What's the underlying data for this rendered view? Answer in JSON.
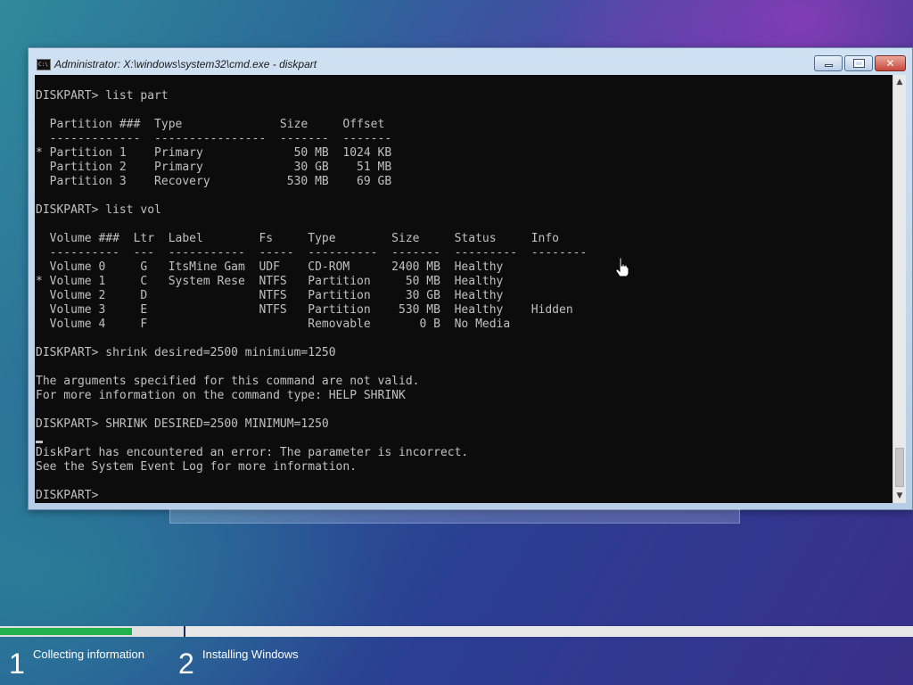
{
  "window": {
    "title": "Administrator: X:\\windows\\system32\\cmd.exe - diskpart",
    "icon": "cmd-icon",
    "controls": {
      "minimize": "minimize-icon",
      "maximize": "maximize-icon",
      "close_glyph": "✕"
    }
  },
  "console": {
    "text": "DISKPART> list part\n\n  Partition ###  Type              Size     Offset\n  -------------  ----------------  -------  -------\n* Partition 1    Primary             50 MB  1024 KB\n  Partition 2    Primary             30 GB    51 MB\n  Partition 3    Recovery           530 MB    69 GB\n\nDISKPART> list vol\n\n  Volume ###  Ltr  Label        Fs     Type        Size     Status     Info\n  ----------  ---  -----------  -----  ----------  -------  ---------  --------\n  Volume 0     G   ItsMine Gam  UDF    CD-ROM      2400 MB  Healthy\n* Volume 1     C   System Rese  NTFS   Partition     50 MB  Healthy\n  Volume 2     D                NTFS   Partition     30 GB  Healthy\n  Volume 3     E                NTFS   Partition    530 MB  Healthy    Hidden\n  Volume 4     F                       Removable       0 B  No Media\n\nDISKPART> shrink desired=2500 minimium=1250\n\nThe arguments specified for this command are not valid.\nFor more information on the command type: HELP SHRINK\n\nDISKPART> SHRINK DESIRED=2500 MINIMUM=1250\n\nDiskPart has encountered an error: The parameter is incorrect.\nSee the System Event Log for more information.\n\nDISKPART>"
  },
  "setup_progress": {
    "completed_fraction_step1": 0.72,
    "fill_color": "#22b14c",
    "steps": [
      {
        "number": "1",
        "label": "Collecting information"
      },
      {
        "number": "2",
        "label": "Installing Windows"
      }
    ]
  },
  "colors": {
    "console_bg": "#0c0c0c",
    "console_text": "#c0c0c0"
  }
}
